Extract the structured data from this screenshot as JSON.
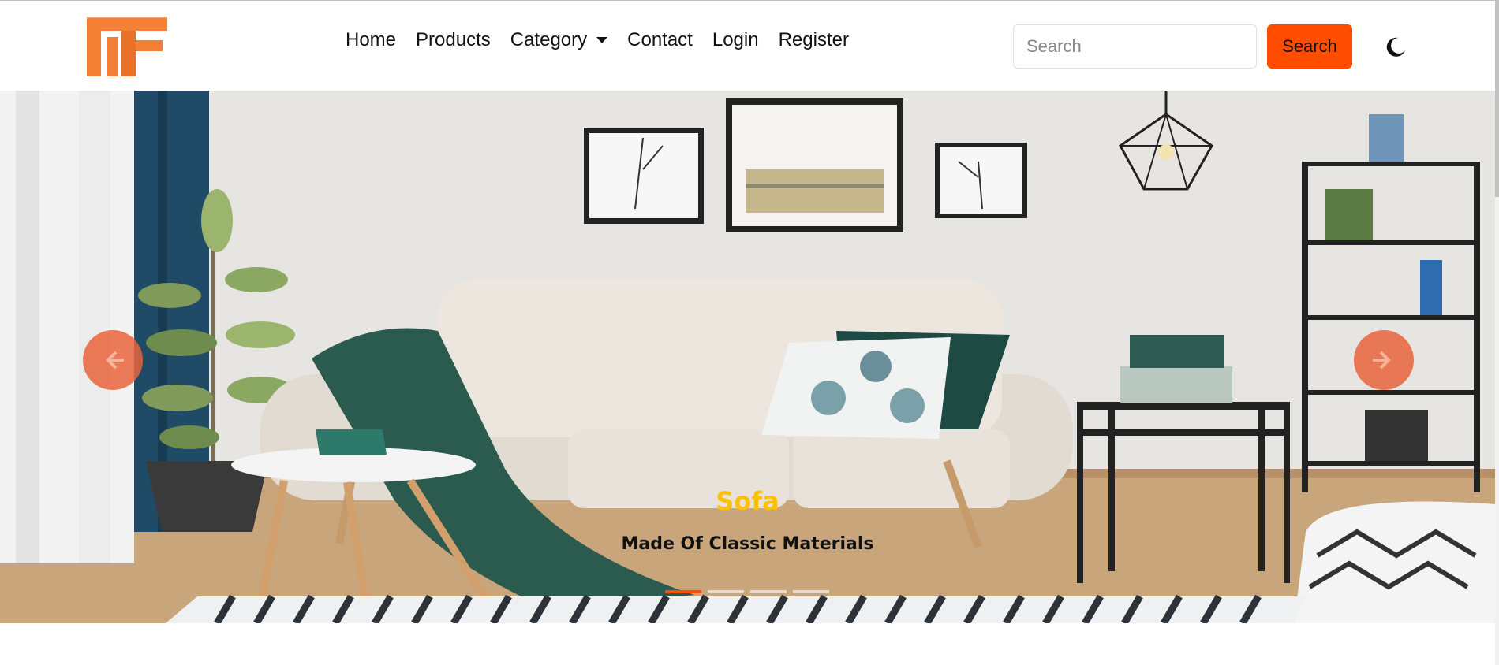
{
  "brand": {
    "logo_icon": "mf-logo-icon",
    "color": "#f28035"
  },
  "nav": {
    "items": [
      {
        "label": "Home"
      },
      {
        "label": "Products"
      },
      {
        "label": "Category"
      },
      {
        "label": "Contact"
      },
      {
        "label": "Login"
      },
      {
        "label": "Register"
      }
    ]
  },
  "search": {
    "placeholder": "Search",
    "value": "",
    "button_label": "Search"
  },
  "theme_toggle": {
    "icon": "moon-icon"
  },
  "carousel": {
    "slide_title": "Sofa",
    "slide_subtitle": "Made Of Classic Materials",
    "slide_count": 4,
    "active_index": 0,
    "prev_icon": "arrow-left-icon",
    "next_icon": "arrow-right-icon"
  },
  "colors": {
    "accent": "#ff4d00",
    "caption_title": "#ffc107"
  }
}
